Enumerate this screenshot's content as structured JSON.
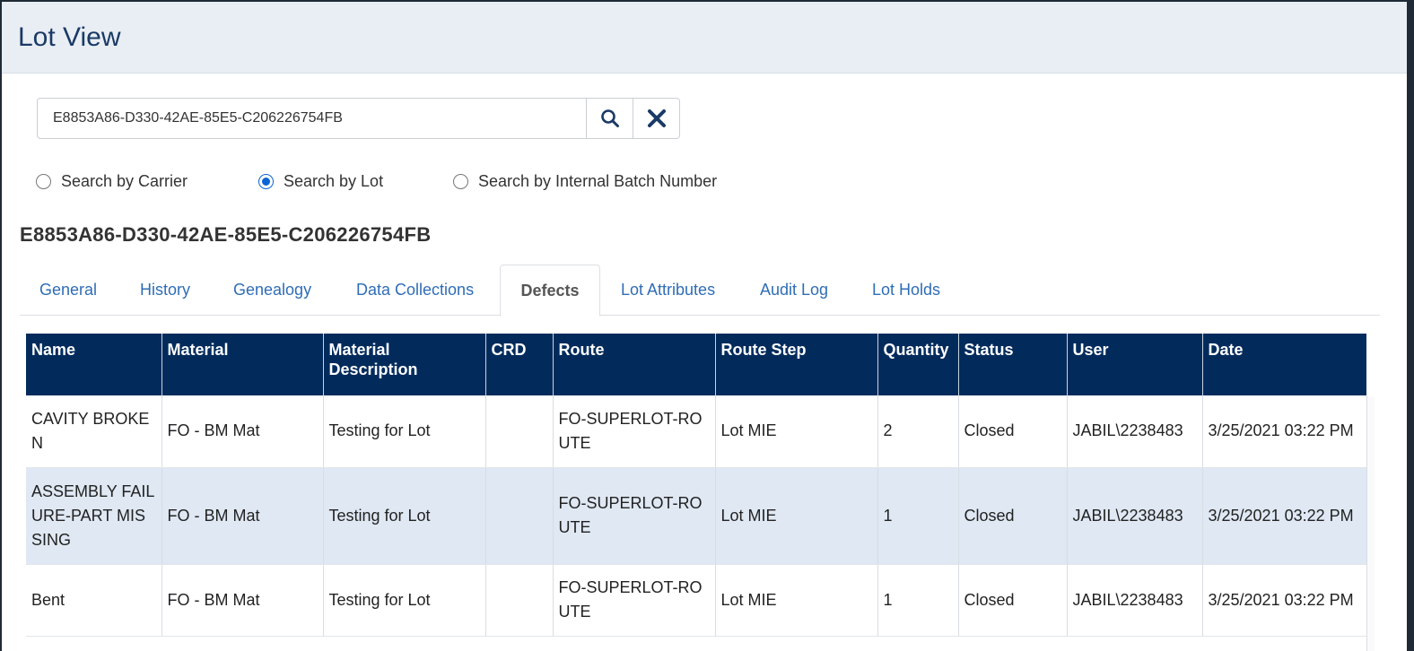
{
  "header": {
    "title": "Lot View"
  },
  "search": {
    "value": "E8853A86-D330-42AE-85E5-C206226754FB",
    "search_icon": "search-icon",
    "clear_icon": "close-icon",
    "options": [
      {
        "label": "Search by Carrier",
        "checked": false
      },
      {
        "label": "Search by Lot",
        "checked": true
      },
      {
        "label": "Search by Internal Batch Number",
        "checked": false
      }
    ]
  },
  "lot": {
    "id": "E8853A86-D330-42AE-85E5-C206226754FB"
  },
  "tabs": [
    {
      "label": "General"
    },
    {
      "label": "History"
    },
    {
      "label": "Genealogy"
    },
    {
      "label": "Data Collections"
    },
    {
      "label": "Defects",
      "active": true
    },
    {
      "label": "Lot Attributes"
    },
    {
      "label": "Audit Log"
    },
    {
      "label": "Lot Holds"
    }
  ],
  "defects_table": {
    "header_color": "#022b5c",
    "columns": [
      "Name",
      "Material",
      "Material Description",
      "CRD",
      "Route",
      "Route Step",
      "Quantity",
      "Status",
      "User",
      "Date"
    ],
    "rows": [
      [
        "CAVITY BROKEN",
        "FO - BM Mat",
        "Testing for Lot",
        "",
        "FO-SUPERLOT-ROUTE",
        "Lot MIE",
        "2",
        "Closed",
        "JABIL\\2238483",
        "3/25/2021 03:22 PM"
      ],
      [
        "ASSEMBLY FAILURE-PART MISSING",
        "FO - BM Mat",
        "Testing for Lot",
        "",
        "FO-SUPERLOT-ROUTE",
        "Lot MIE",
        "1",
        "Closed",
        "JABIL\\2238483",
        "3/25/2021 03:22 PM"
      ],
      [
        "Bent",
        "FO - BM Mat",
        "Testing for Lot",
        "",
        "FO-SUPERLOT-ROUTE",
        "Lot MIE",
        "1",
        "Closed",
        "JABIL\\2238483",
        "3/25/2021 03:22 PM"
      ]
    ]
  }
}
